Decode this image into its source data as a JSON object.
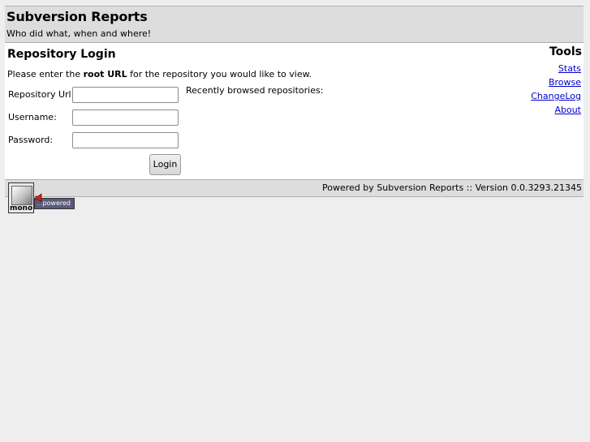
{
  "header": {
    "title": "Subversion Reports",
    "subtitle": "Who did what, when and where!"
  },
  "main": {
    "heading": "Repository Login",
    "intro_prefix": "Please enter the ",
    "intro_bold": "root URL",
    "intro_suffix": " for the repository you would like to view.",
    "repo_url_label": "Repository Url:",
    "username_label": "Username:",
    "password_label": "Password:",
    "repo_url_value": "",
    "username_value": "",
    "password_value": "",
    "recent_label": "Recently browsed repositories:",
    "login_button": "Login"
  },
  "tools": {
    "title": "Tools",
    "links": [
      "Stats",
      "Browse",
      "ChangeLog",
      "About"
    ]
  },
  "footer": {
    "powered_text": "Powered by Subversion Reports :: Version 0.0.3293.21345",
    "logo_text": "mono",
    "badge_dots": "...",
    "badge_text": "powered"
  },
  "colors": {
    "link": "#0000cc",
    "header_bg": "#dddddd",
    "page_bg": "#eeeeee"
  }
}
